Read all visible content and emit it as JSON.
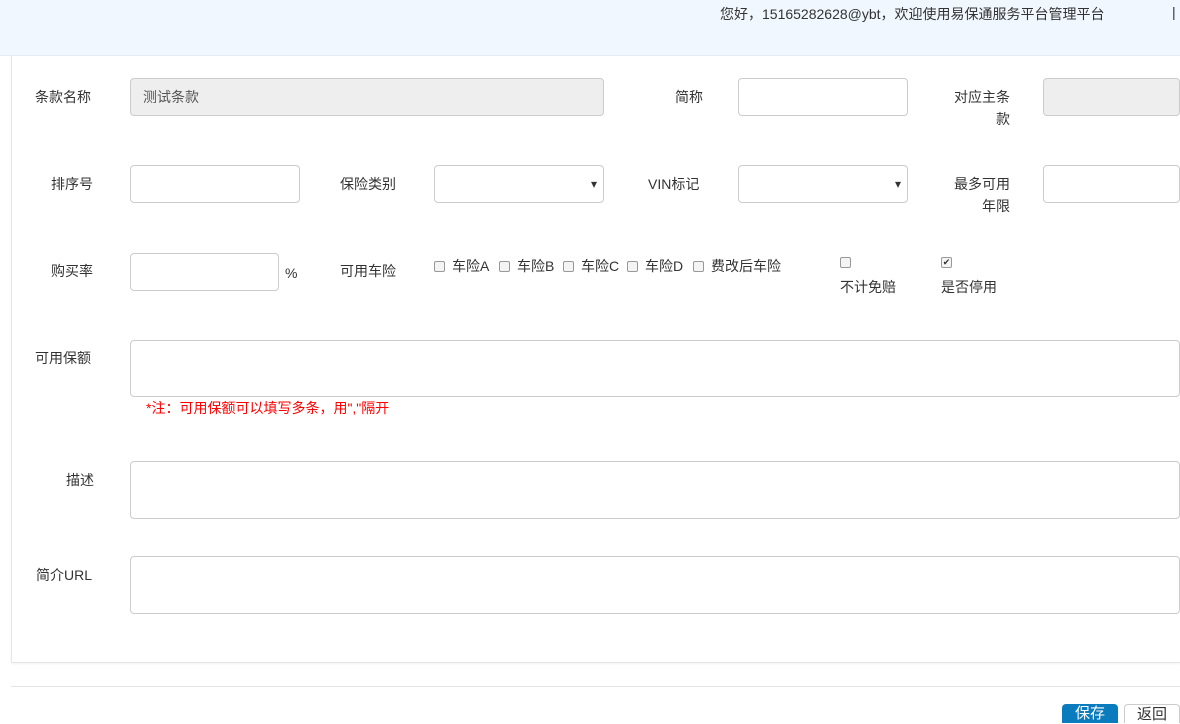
{
  "header": {
    "greeting": "您好，15165282628@ybt，欢迎使用易保通服务平台管理平台",
    "separator": "|"
  },
  "form": {
    "clause_name_label": "条款名称",
    "clause_name_value": "测试条款",
    "short_name_label": "简称",
    "short_name_value": "",
    "main_clause_label_1": "对应主条",
    "main_clause_label_2": "款",
    "sort_label": "排序号",
    "insurance_type_label": "保险类别",
    "vin_label": "VIN标记",
    "max_years_label_1": "最多可用",
    "max_years_label_2": "年限",
    "purchase_rate_label": "购买率",
    "percent": "%",
    "available_insurance_label": "可用车险",
    "checkboxes": [
      {
        "label": "车险A",
        "checked": false
      },
      {
        "label": "车险B",
        "checked": false
      },
      {
        "label": "车险C",
        "checked": false
      },
      {
        "label": "车险D",
        "checked": false
      },
      {
        "label": "费改后车险",
        "checked": false
      }
    ],
    "no_deductible_label": "不计免赔",
    "no_deductible_checked": false,
    "disabled_label": "是否停用",
    "disabled_checked": true,
    "coverage_label": "可用保额",
    "coverage_note": "*注：可用保额可以填写多条，用\",\"隔开",
    "description_label": "描述",
    "intro_url_label": "简介URL"
  },
  "footer": {
    "save": "保存",
    "back": "返回"
  }
}
